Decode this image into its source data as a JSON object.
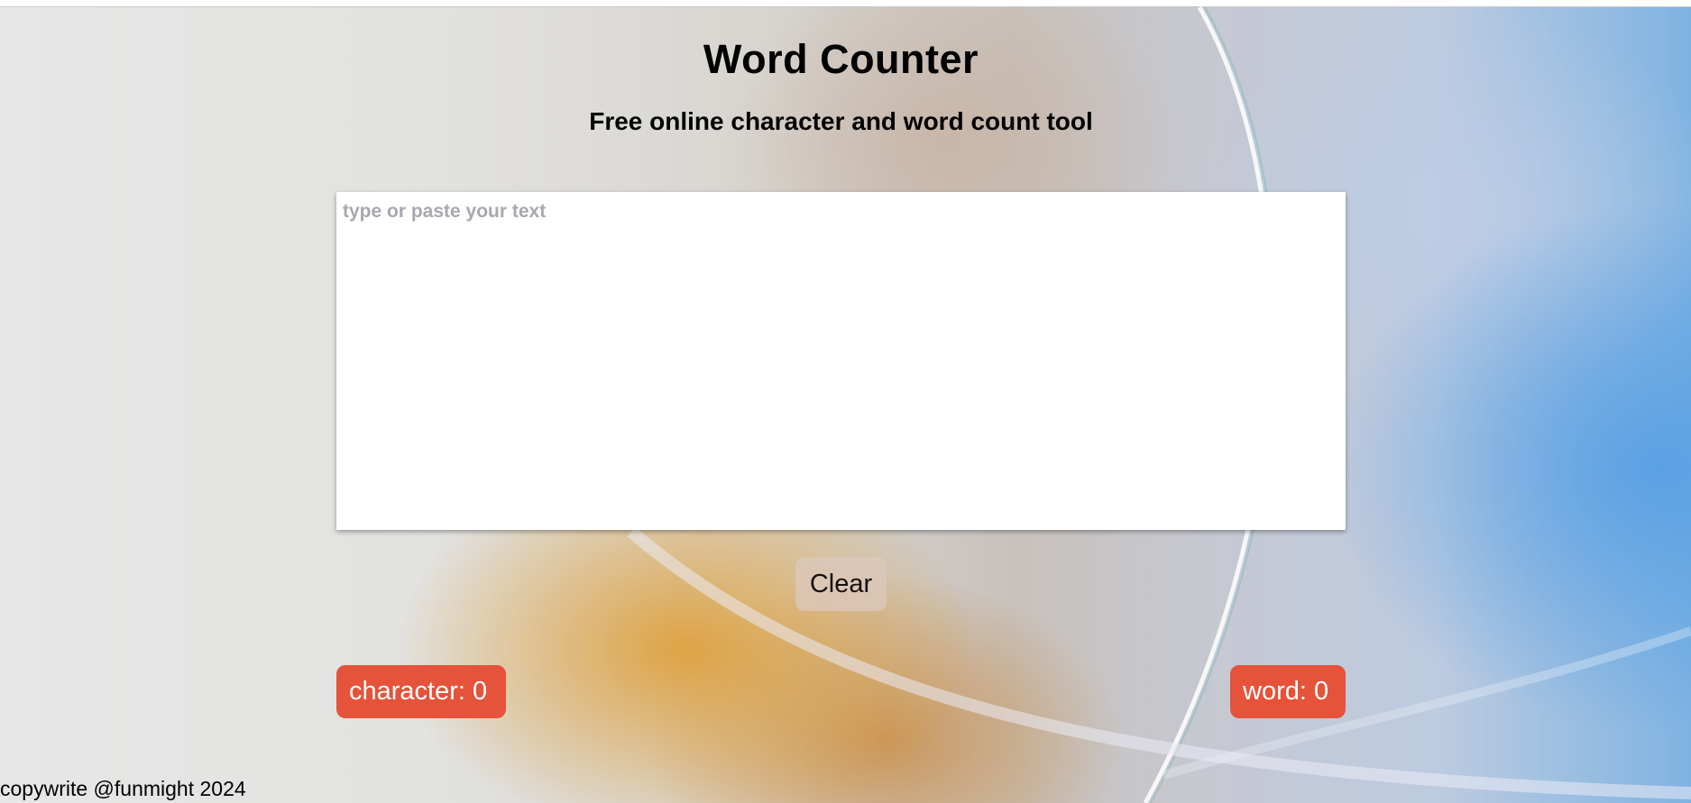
{
  "header": {
    "title": "Word Counter",
    "subtitle": "Free online character and word count tool"
  },
  "editor": {
    "placeholder": "type or paste your text",
    "value": ""
  },
  "actions": {
    "clear_label": "Clear"
  },
  "counts": {
    "character_label": "character: ",
    "character_value": "0",
    "word_label": "word: ",
    "word_value": "0",
    "badge_color": "#e5533a"
  },
  "footer": {
    "text": "copywrite @funmight 2024"
  }
}
